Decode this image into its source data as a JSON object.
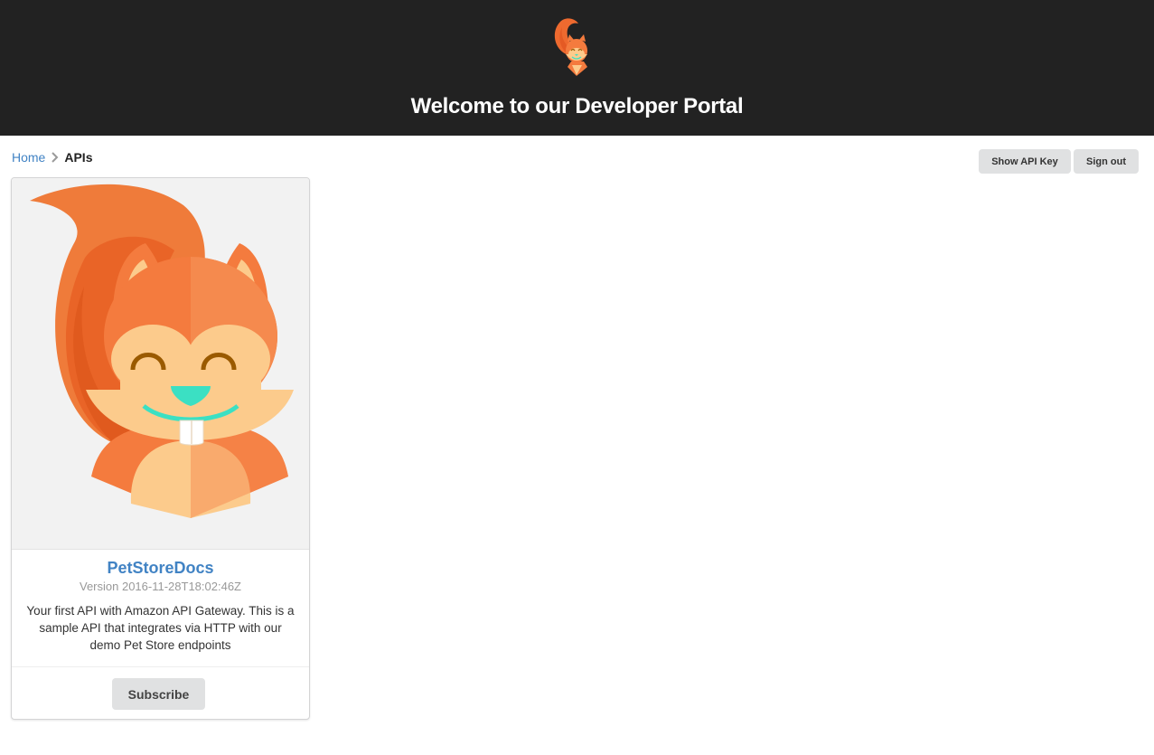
{
  "header": {
    "title": "Welcome to our Developer Portal",
    "logo_icon": "squirrel-logo-icon"
  },
  "breadcrumb": {
    "home_label": "Home",
    "separator_icon": "chevron-right-icon",
    "current_label": "APIs"
  },
  "toolbar": {
    "show_api_key_label": "Show API Key",
    "sign_out_label": "Sign out"
  },
  "api_card": {
    "image_icon": "squirrel-illustration-icon",
    "title": "PetStoreDocs",
    "version": "Version 2016-11-28T18:02:46Z",
    "description": "Your first API with Amazon API Gateway. This is a sample API that integrates via HTTP with our demo Pet Store endpoints",
    "subscribe_label": "Subscribe"
  },
  "colors": {
    "header_bg": "#222222",
    "link": "#4183c4",
    "button_bg": "#e0e1e2",
    "squirrel_orange": "#f47b3e",
    "squirrel_cream": "#fccb8c",
    "squirrel_nose": "#3be0c3"
  }
}
